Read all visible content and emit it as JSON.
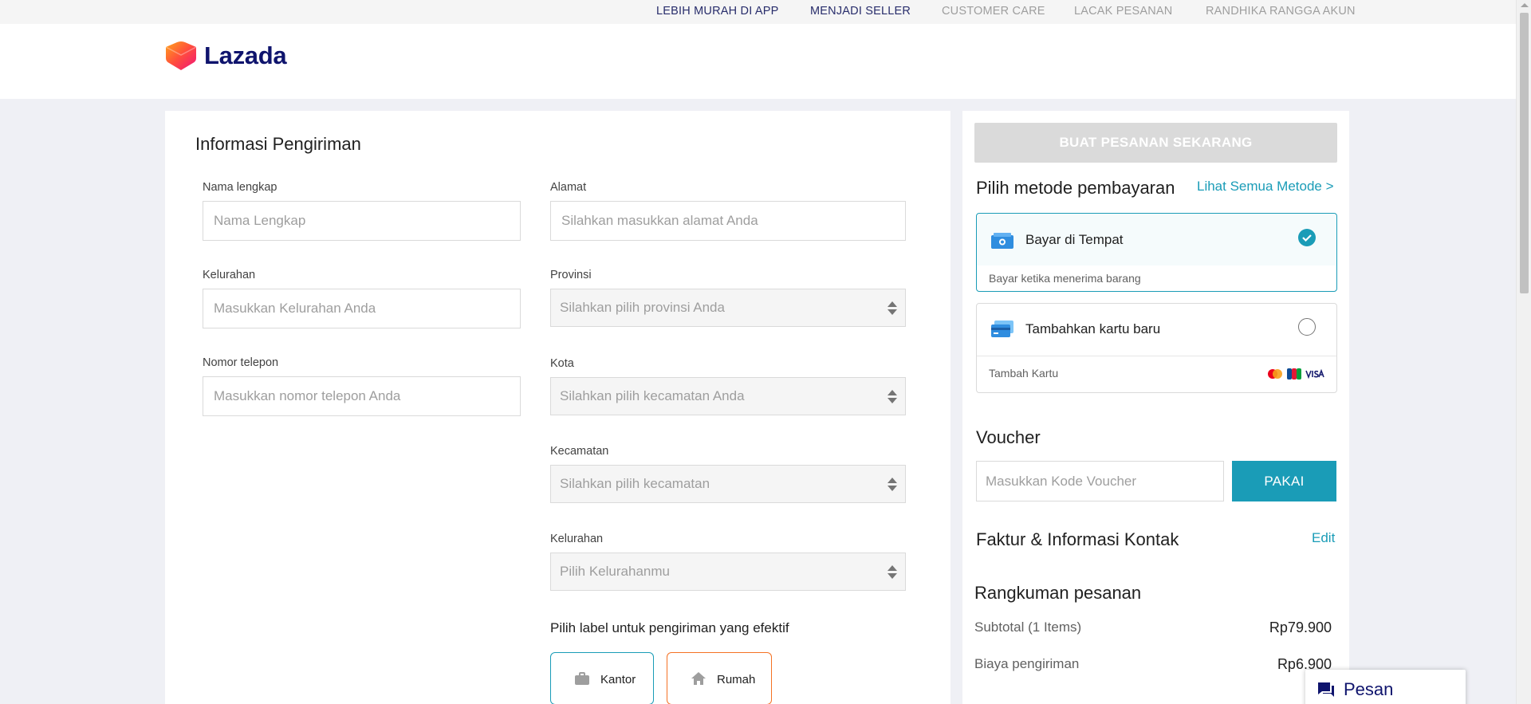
{
  "topbar": {
    "app": "LEBIH MURAH DI APP",
    "seller": "MENJADI SELLER",
    "care": "CUSTOMER CARE",
    "track": "LACAK PESANAN",
    "account": "RANDHIKA RANGGA AKUN"
  },
  "header": {
    "logo_text": "Lazada"
  },
  "shipping": {
    "title": "Informasi Pengiriman",
    "name_label": "Nama lengkap",
    "name_placeholder": "Nama Lengkap",
    "address_label": "Alamat",
    "address_placeholder": "Silahkan masukkan alamat Anda",
    "kelurahan_label": "Kelurahan",
    "kelurahan_placeholder": "Masukkan Kelurahan Anda",
    "province_label": "Provinsi",
    "province_placeholder": "Silahkan pilih provinsi Anda",
    "phone_label": "Nomor telepon",
    "phone_placeholder": "Masukkan nomor telepon Anda",
    "city_label": "Kota",
    "city_placeholder": "Silahkan pilih kecamatan Anda",
    "district_label": "Kecamatan",
    "district_placeholder": "Silahkan pilih kecamatan",
    "subdistrict_label": "Kelurahan",
    "subdistrict_placeholder": "Pilih Kelurahanmu",
    "address_label_prompt": "Pilih label untuk pengiriman yang efektif",
    "label_office": "Kantor",
    "label_home": "Rumah"
  },
  "payment": {
    "order_button": "BUAT PESANAN SEKARANG",
    "title": "Pilih metode pembayaran",
    "see_all": "Lihat Semua Metode >",
    "cod_title": "Bayar di Tempat",
    "cod_sub": "Bayar ketika menerima barang",
    "card_title": "Tambahkan kartu baru",
    "card_sub": "Tambah Kartu",
    "card_brands": [
      "mastercard",
      "JCB",
      "VISA"
    ]
  },
  "voucher": {
    "title": "Voucher",
    "placeholder": "Masukkan Kode Voucher",
    "apply": "PAKAI"
  },
  "invoice": {
    "title": "Faktur & Informasi Kontak",
    "edit": "Edit"
  },
  "summary": {
    "title": "Rangkuman pesanan",
    "subtotal_label": "Subtotal (1 Items)",
    "subtotal_value": "Rp79.900",
    "shipping_label": "Biaya pengiriman",
    "shipping_value": "Rp6.900"
  },
  "chat": {
    "label": "Pesan"
  },
  "colors": {
    "accent": "#1a9cb7",
    "brand_navy": "#0f146d",
    "home_border": "#f57224",
    "disabled_button": "#dadada"
  }
}
